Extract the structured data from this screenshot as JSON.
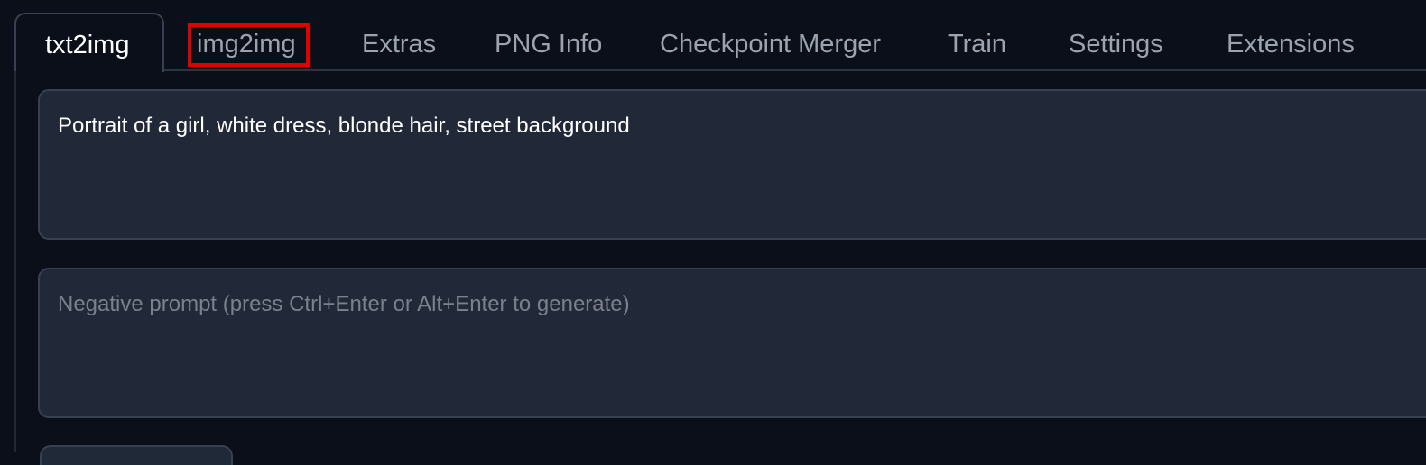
{
  "tabs": [
    {
      "label": "txt2img",
      "active": true
    },
    {
      "label": "img2img",
      "highlighted": true
    },
    {
      "label": "Extras"
    },
    {
      "label": "PNG Info"
    },
    {
      "label": "Checkpoint Merger"
    },
    {
      "label": "Train"
    },
    {
      "label": "Settings"
    },
    {
      "label": "Extensions"
    }
  ],
  "prompt": {
    "value": "Portrait of a girl, white dress, blonde hair, street background"
  },
  "negative_prompt": {
    "placeholder": "Negative prompt (press Ctrl+Enter or Alt+Enter to generate)"
  },
  "colors": {
    "background": "#0b0f19",
    "panel": "#1f2937",
    "highlight": "#e10000"
  }
}
